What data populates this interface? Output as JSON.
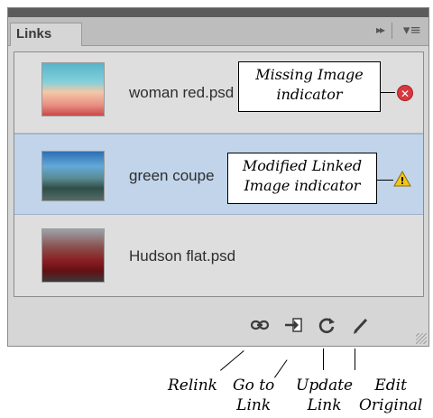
{
  "panel": {
    "tab_label": "Links",
    "fast_forward_glyph": "▸▸",
    "menu_glyph": "▾≡"
  },
  "links": [
    {
      "filename": "woman red.psd",
      "status": "missing",
      "thumbnail": "woman-underwater-photo"
    },
    {
      "filename": "green coupe",
      "status": "modified",
      "thumbnail": "green-coupe-photo"
    },
    {
      "filename": "Hudson flat.psd",
      "status": "ok",
      "thumbnail": "red-hudson-car-photo"
    }
  ],
  "callouts": {
    "missing": {
      "line1": "Missing Image",
      "line2": "indicator"
    },
    "modified": {
      "line1": "Modified Linked",
      "line2": "Image indicator"
    }
  },
  "status_glyphs": {
    "missing": "✕",
    "modified": "!"
  },
  "toolbar": {
    "relink_icon": "chain-link-icon",
    "goto_icon": "arrow-to-page-icon",
    "update_icon": "refresh-icon",
    "edit_icon": "pencil-icon"
  },
  "labels": {
    "relink": "Relink",
    "goto_line1": "Go to",
    "goto_line2": "Link",
    "update_line1": "Update",
    "update_line2": "Link",
    "edit_line1": "Edit",
    "edit_line2": "Original"
  },
  "colors": {
    "selected_row": "#c1d4ea",
    "missing_badge": "#d7383f",
    "warning_triangle": "#f2c51c"
  }
}
